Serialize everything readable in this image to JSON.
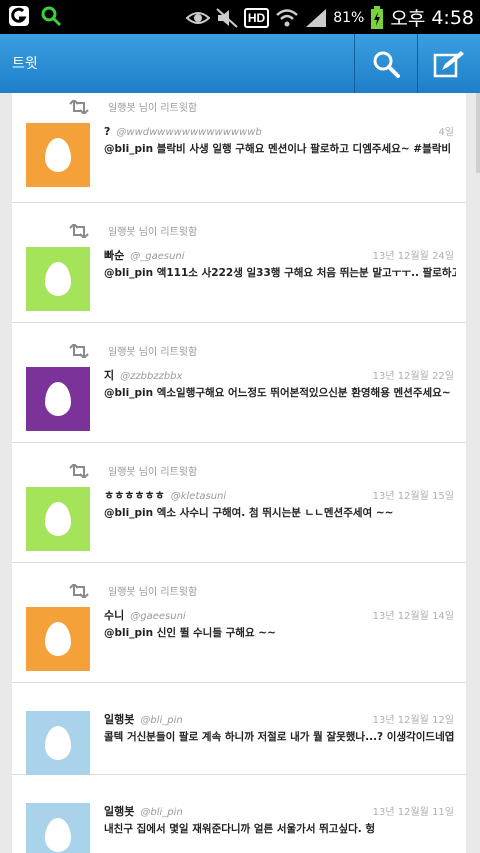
{
  "status_bar": {
    "battery": "81%",
    "time_period": "오후",
    "clock": "4:58",
    "hd": "HD"
  },
  "app_bar": {
    "title": "트윗"
  },
  "colors": {
    "accent": "#2a8fd6",
    "avatar_orange": "#f5a13a",
    "avatar_green": "#a4e35a",
    "avatar_purple": "#7b3399",
    "avatar_lightblue": "#a8d3ea"
  },
  "retweet_label": "일행봇 님이 리트윗함",
  "tweets": [
    {
      "retweeted": true,
      "avatar_color": "#f5a13a",
      "name": "?",
      "handle": "@wwdwwwwwwwwwwwwwb",
      "time": "4일",
      "mention": "@bli_pin",
      "text": " 블락비 사생 일행 구해요 멘션이나 팔로하고 디엠주세요~ #블락비"
    },
    {
      "retweeted": true,
      "avatar_color": "#a4e35a",
      "name": "빠순",
      "handle": "@_gaesuni",
      "time": "13년 12월월 24일",
      "mention": "@bli_pin",
      "text": " 액111소 사222생 일33행 구해요 처음 뛰는분 말고ㅜㅜ.. 팔로하고 멘션줌여"
    },
    {
      "retweeted": true,
      "avatar_color": "#7b3399",
      "name": "지",
      "handle": "@zzbbzzbbx",
      "time": "13년 12월월 22일",
      "mention": "@bli_pin",
      "text": " 엑소일행구해요 어느정도 뛰어본적있으신분 환영해용 멘션주세요~"
    },
    {
      "retweeted": true,
      "avatar_color": "#a4e35a",
      "name": "ㅎㅎㅎㅎㅎㅎ",
      "handle": "@kletasuni",
      "time": "13년 12월월 15일",
      "mention": "@bli_pin",
      "text": " 엑소 사수니 구해여. 첨 뛰시는분 ㄴㄴ멘션주세여 ~~"
    },
    {
      "retweeted": true,
      "avatar_color": "#f5a13a",
      "name": "수니",
      "handle": "@gaeesuni",
      "time": "13년 12월월 14일",
      "mention": "@bli_pin",
      "text": " 신인 뛸 수니들 구해요 ~~"
    },
    {
      "retweeted": false,
      "avatar_color": "#a8d3ea",
      "name": "일행봇",
      "handle": "@bli_pin",
      "time": "13년 12월월 12일",
      "mention": "",
      "text": "콜텍 거신분들이 팔로 계속 하니까 저절로 내가 뭘 잘못했나...? 이생각이드네엽ㅋㅋㅋ"
    },
    {
      "retweeted": false,
      "avatar_color": "#a8d3ea",
      "name": "일행봇",
      "handle": "@bli_pin",
      "time": "13년 12월월 11일",
      "mention": "",
      "text": "내친구 집에서 몇일 재워준다니까 얼른 서울가서 뛰고싶다. 헝"
    }
  ]
}
